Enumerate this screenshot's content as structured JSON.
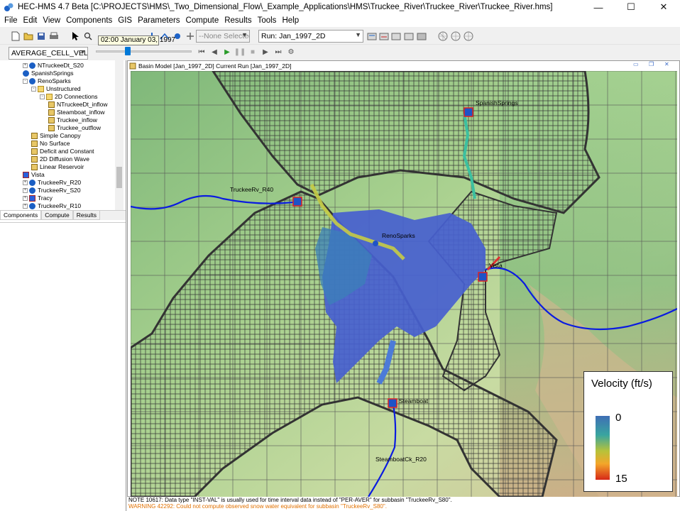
{
  "window": {
    "title": "HEC-HMS 4.7 Beta [C:\\PROJECTS\\HMS\\_Two_Dimensional_Flow\\_Example_Applications\\HMS\\Truckee_River\\Truckee_River\\Truckee_River.hms]",
    "minimize": "—",
    "maximize": "☐",
    "close": "✕"
  },
  "menu": [
    "File",
    "Edit",
    "View",
    "Components",
    "GIS",
    "Parameters",
    "Compute",
    "Results",
    "Tools",
    "Help"
  ],
  "toolbar": {
    "selection_combo": "--None Selected--",
    "run_combo": "Run: Jan_1997_2D",
    "tooltip": "02:00 January 03, 1997",
    "results_combo": "AVERAGE_CELL_VELOCITY",
    "time_slider_fraction": 0.33
  },
  "tree": {
    "items": [
      {
        "label": "NTruckeeDt_S20",
        "type": "node",
        "indent": 0,
        "expander": "+"
      },
      {
        "label": "SpanishSprings",
        "type": "node",
        "indent": 0,
        "expander": ""
      },
      {
        "label": "RenoSparks",
        "type": "node",
        "indent": 0,
        "expander": "-"
      },
      {
        "label": "Unstructured",
        "type": "folder",
        "indent": 1,
        "expander": "-"
      },
      {
        "label": "2D Connections",
        "type": "folder",
        "indent": 2,
        "expander": "-"
      },
      {
        "label": "NTruckeeDt_inflow",
        "type": "sub",
        "indent": 3,
        "expander": ""
      },
      {
        "label": "Steamboat_inflow",
        "type": "sub",
        "indent": 3,
        "expander": ""
      },
      {
        "label": "Truckee_inflow",
        "type": "sub",
        "indent": 3,
        "expander": ""
      },
      {
        "label": "Truckee_outflow",
        "type": "sub",
        "indent": 3,
        "expander": ""
      },
      {
        "label": "Simple Canopy",
        "type": "sub",
        "indent": 1,
        "expander": ""
      },
      {
        "label": "No Surface",
        "type": "sub",
        "indent": 1,
        "expander": ""
      },
      {
        "label": "Deficit and Constant",
        "type": "sub",
        "indent": 1,
        "expander": ""
      },
      {
        "label": "2D Diffusion Wave",
        "type": "sub",
        "indent": 1,
        "expander": ""
      },
      {
        "label": "Linear Reservoir",
        "type": "sub",
        "indent": 1,
        "expander": ""
      },
      {
        "label": "Vista",
        "type": "junc",
        "indent": 0,
        "expander": ""
      },
      {
        "label": "TruckeeRv_R20",
        "type": "node",
        "indent": 0,
        "expander": "+"
      },
      {
        "label": "TruckeeRv_S20",
        "type": "node",
        "indent": 0,
        "expander": "+"
      },
      {
        "label": "Tracy",
        "type": "junc",
        "indent": 0,
        "expander": "+"
      },
      {
        "label": "TruckeeRv_R10",
        "type": "node",
        "indent": 0,
        "expander": "+"
      }
    ]
  },
  "tabs": [
    "Components",
    "Compute",
    "Results"
  ],
  "map": {
    "title": "Basin Model [Jan_1997_2D] Current Run [Jan_1997_2D]",
    "labels": {
      "spanish_springs": "SpanishSprings",
      "truckee_r40": "TruckeeRv_R40",
      "reno_sparks": "RenoSparks",
      "vista": "Vista",
      "steamboat": "Steamboat",
      "steamboat_r20": "SteamboatCk_R20"
    }
  },
  "legend": {
    "title": "Velocity (ft/s)",
    "max": "0",
    "min": "15"
  },
  "status": {
    "line1": "NOTE 10617: Data type \"INST-VAL\" is usually used for time interval data instead of \"PER-AVER\" for subbasin \"TruckeeRv_S80\".",
    "line2": "WARNING 42292: Could not compute observed snow water equivalent for subbasin \"TruckeeRv_S80\"."
  }
}
